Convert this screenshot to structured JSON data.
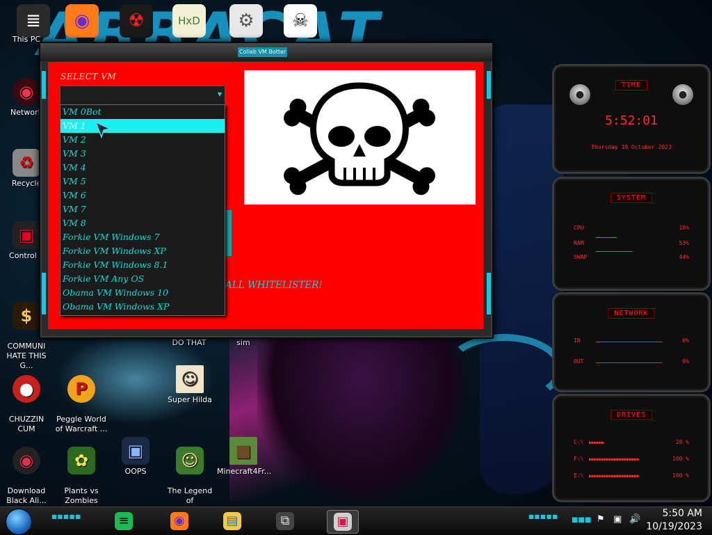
{
  "wallpaper": {
    "graffiti_text": "ABBACAT"
  },
  "top_icons": [
    {
      "name": "this-pc",
      "glyph": "≣",
      "bg": "#2a2a2a",
      "fg": "#ffffff"
    },
    {
      "name": "firefox",
      "glyph": "◉",
      "bg": "#ff7b1a",
      "fg": "#6a2ad8"
    },
    {
      "name": "radiation",
      "glyph": "☢",
      "bg": "#1a1a1a",
      "fg": "#ff2020"
    },
    {
      "name": "hxd",
      "glyph": "HxD",
      "bg": "#f4f0d8",
      "fg": "#3b7a2a"
    },
    {
      "name": "fish-gear",
      "glyph": "⚙",
      "bg": "#e8e8e8",
      "fg": "#555555"
    },
    {
      "name": "skull-spiral",
      "glyph": "☠",
      "bg": "#ffffff",
      "fg": "#111111"
    }
  ],
  "desktop_icons": {
    "this_pc": "This PC",
    "network": "Network",
    "recycle": "Recycle",
    "control": "Control P",
    "communism": "COMMUNI\nHATE THIS G...",
    "do_that": "DO THAT",
    "sim": "sim",
    "chuzzin": "CHUZZIN\nCUM",
    "peggle": "Peggle World\nof Warcraft ...",
    "super_hilda": "Super Hilda",
    "download": "Download\nBlack Ali...",
    "pvz": "Plants vs\nZombies",
    "oops": "OOPS",
    "zilda": "The Legend of\nZilda",
    "minecraft": "Minecraft4Fr..."
  },
  "app": {
    "title": "Collab VM Botter",
    "select_label": "SELECT VM",
    "combo_value": "",
    "vm_options": [
      "VM 0Bot",
      "VM 1",
      "VM 2",
      "VM 3",
      "VM 4",
      "VM 5",
      "VM 6",
      "VM 7",
      "VM 8",
      "Forkie VM Windows 7",
      "Forkie VM Windows XP",
      "Forkie VM Windows 8.1",
      "Forkie VM Any OS",
      "Obama VM Windows 10",
      "Obama VM Windows XP"
    ],
    "selected_index": 1,
    "whitelister_text": "ALL WHITELISTER!"
  },
  "gadgets": {
    "time": {
      "title": "TIME",
      "clock": "5:52:01",
      "date": "Thursday 19 October 2023"
    },
    "system": {
      "title": "SYSTEM",
      "rows": [
        {
          "label": "CPU",
          "value": "10%"
        },
        {
          "label": "RAM",
          "value": "53%"
        },
        {
          "label": "SWAP",
          "value": "44%"
        }
      ]
    },
    "network": {
      "title": "NETWORK",
      "rows": [
        {
          "label": "IN",
          "value": "0%"
        },
        {
          "label": "OUT",
          "value": "0%"
        }
      ]
    },
    "drives": {
      "title": "DRIVES",
      "rows": [
        {
          "label": "C:\\",
          "value": "28 %"
        },
        {
          "label": "F:\\",
          "value": "100 %"
        },
        {
          "label": "E:\\",
          "value": "100 %"
        }
      ]
    }
  },
  "taskbar": {
    "time": "5:50 AM",
    "date": "10/19/2023",
    "apps": [
      {
        "name": "spotify",
        "glyph": "≡",
        "bg": "#1db954",
        "fg": "#000000",
        "active": false
      },
      {
        "name": "firefox",
        "glyph": "◉",
        "bg": "#ff7b1a",
        "fg": "#6a2ad8",
        "active": false
      },
      {
        "name": "file-explorer",
        "glyph": "▤",
        "bg": "#f3c94b",
        "fg": "#3a6ea5",
        "active": false
      },
      {
        "name": "task-view",
        "glyph": "⧉",
        "bg": "#444444",
        "fg": "#dddddd",
        "active": false
      },
      {
        "name": "collab-vm-botter",
        "glyph": "▣",
        "bg": "#d0d0d0",
        "fg": "#d0184a",
        "active": true
      }
    ]
  },
  "colors": {
    "accent_cyan": "#16d8d8",
    "form_bg": "#ff0000",
    "gadget_red": "#ff2a2a"
  }
}
